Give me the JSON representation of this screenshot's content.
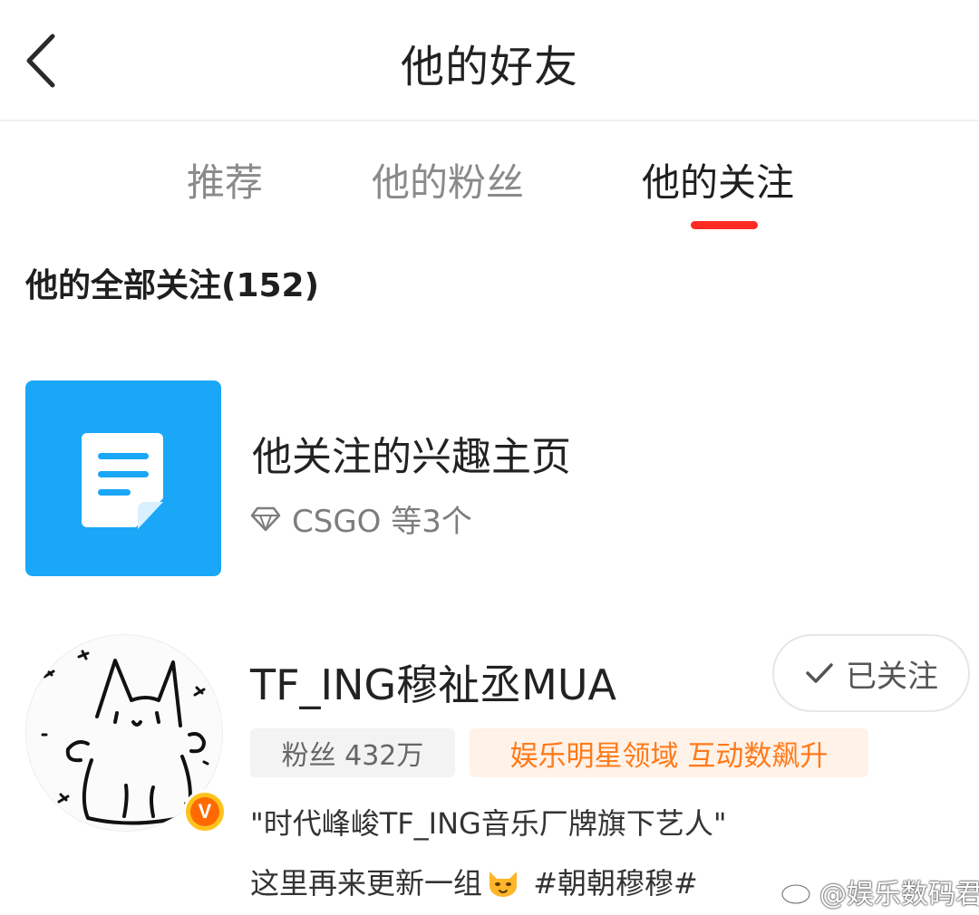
{
  "header": {
    "title": "他的好友"
  },
  "tabs": [
    {
      "label": "推荐",
      "active": false
    },
    {
      "label": "他的粉丝",
      "active": false
    },
    {
      "label": "他的关注",
      "active": true
    }
  ],
  "colors": {
    "accent": "#ff2a24",
    "interest_tile": "#1aa7f7",
    "hot_tag_text": "#ff7a1a",
    "hot_tag_bg": "#fff2e8",
    "verified_badge": "#ffc21c"
  },
  "following": {
    "heading": "他的全部关注(152)"
  },
  "interest_pages": {
    "title": "他关注的兴趣主页",
    "icon": "document-icon",
    "subtitle": "CSGO 等3个",
    "subtitle_icon": "diamond-icon"
  },
  "users": [
    {
      "name": "TF_ING穆祉丞MUA",
      "avatar": "cat-doodle-avatar",
      "verified": true,
      "verified_badge_letter": "V",
      "follow_button": "已关注",
      "fans": "粉丝 432万",
      "hot_tag": "娱乐明星领域 互动数飙升",
      "description_line1": "\"时代峰峻TF_ING音乐厂牌旗下艺人\"",
      "description_line2_before": "这里再来更新一组",
      "description_line2_emoji": "cat-emoji",
      "description_line2_after": " #朝朝穆穆#"
    }
  ],
  "watermark": {
    "text": "@娱乐数码君",
    "icon": "weibo-logo-icon"
  }
}
